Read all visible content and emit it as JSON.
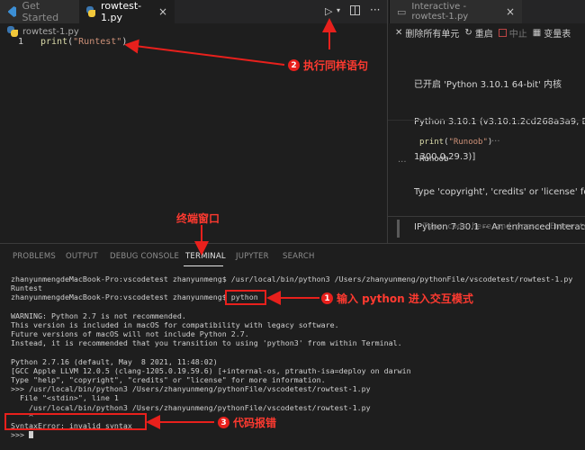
{
  "tabs": [
    {
      "label": "Get Started",
      "icon": "vscode-icon"
    },
    {
      "label": "rowtest-1.py",
      "icon": "python-icon"
    },
    {
      "label": "Interactive - rowtest-1.py",
      "icon": "interactive-window-icon"
    }
  ],
  "editor": {
    "breadcrumb": "rowtest-1.py",
    "line_number": "1",
    "code": {
      "func": "print",
      "open": "(",
      "arg": "\"Runtest\"",
      "close": ")"
    }
  },
  "interactive": {
    "toolbar": {
      "clear_all": "删除所有单元",
      "restart": "重启",
      "interrupt": "中止",
      "variables": "变量表"
    },
    "output_lines": [
      "已开启 'Python 3.10.1 64-bit' 内核",
      "Python 3.10.1 (v3.10.1:2cd268a3a9, Dec",
      "1300.0.29.3)]",
      "Type 'copyright', 'credits' or 'license' for",
      "IPython 7.30.1 -- An enhanced Interactive"
    ],
    "cell_code": {
      "func": "print",
      "open": "(",
      "arg": "\"Runoob\"",
      "close": ")"
    },
    "cell_more": "···",
    "cell_output_dots": "...",
    "cell_output": "Runoob",
    "input_placeholder": "Type code here and press ⇧Enter to"
  },
  "panel": {
    "tabs": [
      "PROBLEMS",
      "OUTPUT",
      "DEBUG CONSOLE",
      "TERMINAL",
      "JUPYTER",
      "SEARCH"
    ],
    "active_tab": "TERMINAL",
    "terminal_lines": [
      "zhanyunmengdeMacBook-Pro:vscodetest zhanyunmeng$ /usr/local/bin/python3 /Users/zhanyunmeng/pythonFile/vscodetest/rowtest-1.py",
      "Runtest",
      "zhanyunmengdeMacBook-Pro:vscodetest zhanyunmeng$ python",
      "",
      "WARNING: Python 2.7 is not recommended.",
      "This version is included in macOS for compatibility with legacy software.",
      "Future versions of macOS will not include Python 2.7.",
      "Instead, it is recommended that you transition to using 'python3' from within Terminal.",
      "",
      "Python 2.7.16 (default, May  8 2021, 11:48:02)",
      "[GCC Apple LLVM 12.0.5 (clang-1205.0.19.59.6) [+internal-os, ptrauth-isa=deploy on darwin",
      "Type \"help\", \"copyright\", \"credits\" or \"license\" for more information.",
      ">>> /usr/local/bin/python3 /Users/zhanyunmeng/pythonFile/vscodetest/rowtest-1.py",
      "  File \"<stdin>\", line 1",
      "    /usr/local/bin/python3 /Users/zhanyunmeng/pythonFile/vscodetest/rowtest-1.py",
      "    ^",
      "SyntaxError: invalid syntax",
      ">>> "
    ]
  },
  "annotations": {
    "a2": {
      "num": "2",
      "text": "执行同样语句"
    },
    "terminal_window": {
      "text": "终端窗口"
    },
    "a1": {
      "num": "1",
      "text": "输入 python 进入交互模式"
    },
    "a3": {
      "num": "3",
      "text": "代码报错"
    }
  },
  "colors": {
    "annotation": "#e8201c",
    "string": "#ce9178",
    "function": "#dcdcaa"
  }
}
